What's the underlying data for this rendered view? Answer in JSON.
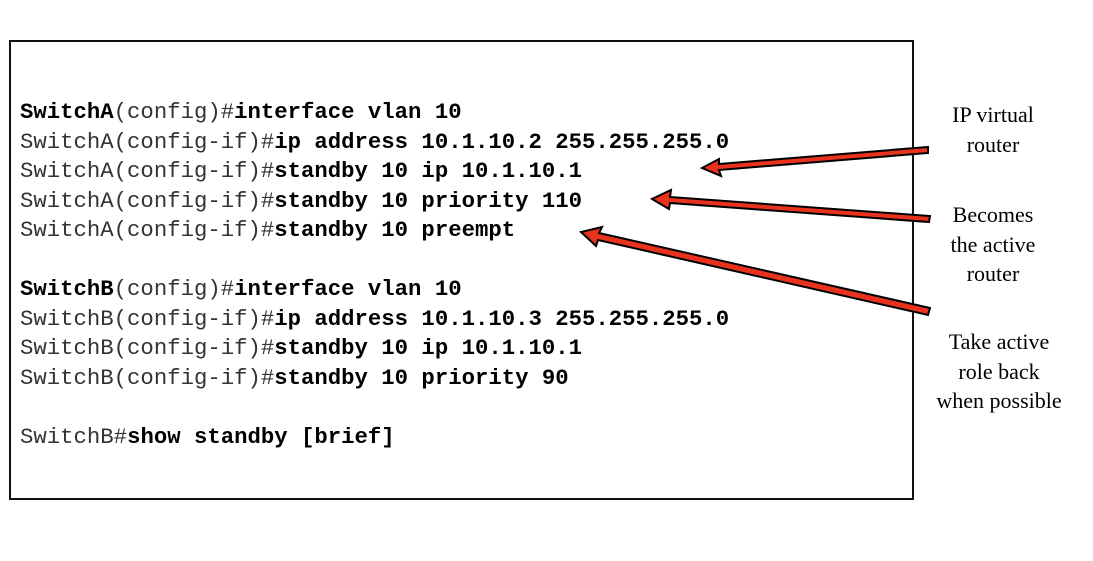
{
  "config": {
    "switch_a": [
      {
        "host": "SwitchA",
        "mode": "(config)#",
        "command": "interface vlan 10",
        "host_bold": true
      },
      {
        "host": "SwitchA",
        "mode": "(config-if)#",
        "command": "ip address 10.1.10.2 255.255.255.0",
        "host_bold": false
      },
      {
        "host": "SwitchA",
        "mode": "(config-if)#",
        "command": "standby 10 ip 10.1.10.1",
        "host_bold": false
      },
      {
        "host": "SwitchA",
        "mode": "(config-if)#",
        "command": "standby 10 priority 110",
        "host_bold": false
      },
      {
        "host": "SwitchA",
        "mode": "(config-if)#",
        "command": "standby 10 preempt",
        "host_bold": false
      }
    ],
    "switch_b": [
      {
        "host": "SwitchB",
        "mode": "(config)#",
        "command": "interface vlan 10",
        "host_bold": true
      },
      {
        "host": "SwitchB",
        "mode": "(config-if)#",
        "command": "ip address 10.1.10.3 255.255.255.0",
        "host_bold": false
      },
      {
        "host": "SwitchB",
        "mode": "(config-if)#",
        "command": "standby 10 ip 10.1.10.1",
        "host_bold": false
      },
      {
        "host": "SwitchB",
        "mode": "(config-if)#",
        "command": "standby 10 priority 90",
        "host_bold": false
      }
    ],
    "show": {
      "host": "SwitchB",
      "mode": "#",
      "command": "show standby [brief]"
    }
  },
  "annotations": [
    {
      "lines": [
        "IP virtual",
        "router"
      ],
      "points_to": "standby 10 ip 10.1.10.1"
    },
    {
      "lines": [
        "Becomes",
        "the active",
        "router"
      ],
      "points_to": "standby 10 priority 110"
    },
    {
      "lines": [
        "Take active",
        "role back",
        "when possible"
      ],
      "points_to": "standby 10 preempt"
    }
  ],
  "colors": {
    "arrow_fill": "#e8321e",
    "arrow_outline": "#000000",
    "frame": "#111111"
  }
}
